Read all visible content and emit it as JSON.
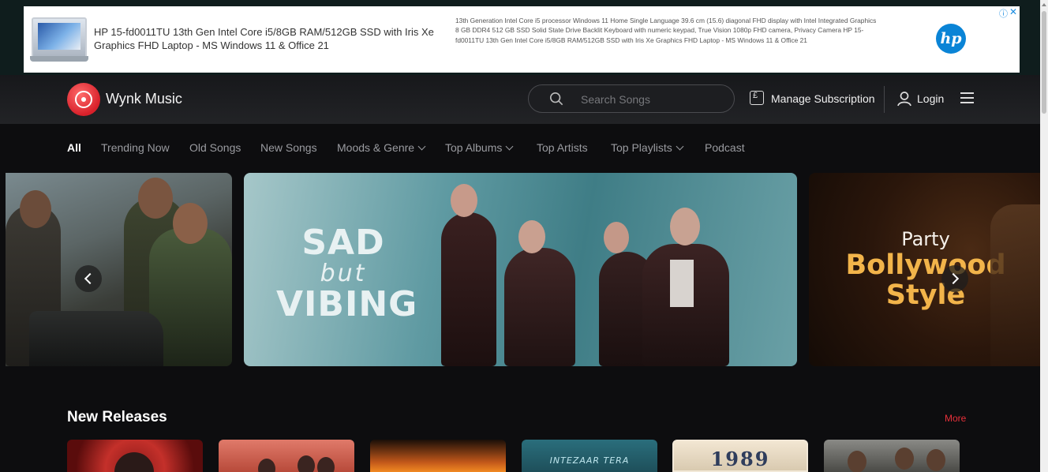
{
  "ad": {
    "title": "HP 15-fd0011TU 13th Gen Intel Core i5/8GB RAM/512GB SSD with Iris Xe Graphics FHD Laptop - MS Windows 11 & Office 21",
    "description": "13th Generation Intel Core i5 processor Windows 11 Home Single Language 39.6 cm (15.6) diagonal FHD display with Intel Integrated Graphics 8 GB DDR4 512 GB SSD Solid State Drive Backlit Keyboard with numeric keypad, True Vision 1080p FHD camera, Privacy Camera HP 15-fd0011TU 13th Gen Intel Core i5/8GB RAM/512GB SSD with Iris Xe Graphics FHD Laptop - MS Windows 11 & Office 21",
    "logo_text": "hp",
    "info_icon": "info-icon",
    "close_icon": "close-icon"
  },
  "header": {
    "brand": "Wynk Music",
    "search_placeholder": "Search Songs",
    "manage_subscription": "Manage Subscription",
    "login": "Login"
  },
  "nav": {
    "items": [
      {
        "label": "All",
        "active": true
      },
      {
        "label": "Trending Now"
      },
      {
        "label": "Old Songs"
      },
      {
        "label": "New Songs"
      },
      {
        "label": "Moods & Genre",
        "dropdown": true
      },
      {
        "label": "Top Albums",
        "dropdown": true
      },
      {
        "label": "Top Artists"
      },
      {
        "label": "Top Playlists",
        "dropdown": true
      },
      {
        "label": "Podcast"
      }
    ]
  },
  "carousel": {
    "main": {
      "line1": "SAD",
      "line2": "but",
      "line3": "VIBING"
    },
    "right": {
      "line1": "Party",
      "line2": "Bollywood",
      "line3": "Style"
    }
  },
  "new_releases": {
    "title": "New Releases",
    "more": "More",
    "card4_text": "INTEZAAR TERA",
    "card5_text": "1989"
  },
  "colors": {
    "accent": "#e8303a",
    "background": "#0d0d0f",
    "header": "#1c1d20",
    "party_gold": "#f2b44a"
  }
}
